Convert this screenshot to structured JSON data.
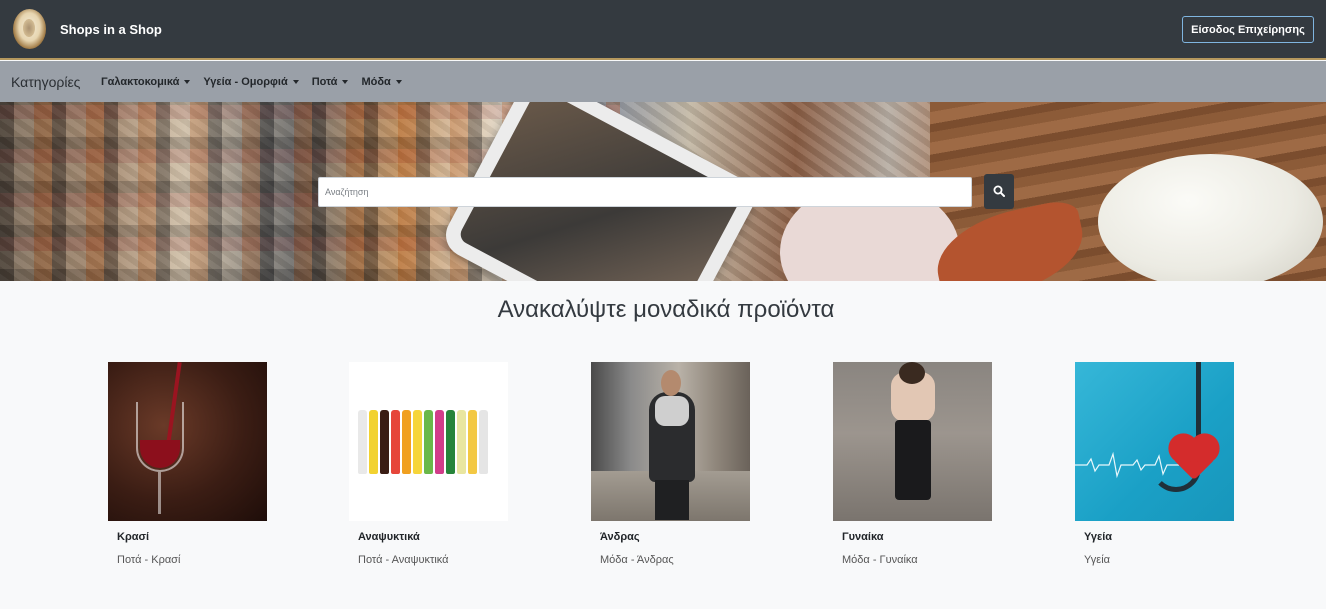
{
  "header": {
    "brand": "Shops in a Shop",
    "login_button": "Είσοδος Επιχείρησης"
  },
  "categories": {
    "title": "Κατηγορίες",
    "items": [
      {
        "label": "Γαλακτοκομικά"
      },
      {
        "label": "Υγεία - Ομορφιά"
      },
      {
        "label": "Ποτά"
      },
      {
        "label": "Μόδα"
      }
    ]
  },
  "search": {
    "placeholder": "Αναζήτηση",
    "button_icon": "search-icon"
  },
  "main": {
    "headline": "Ανακαλύψτε μοναδικά προϊόντα",
    "products": [
      {
        "name": "Κρασί",
        "category": "Ποτά - Κρασί"
      },
      {
        "name": "Αναψυκτικά",
        "category": "Ποτά - Αναψυκτικά"
      },
      {
        "name": "Άνδρας",
        "category": "Μόδα - Άνδρας"
      },
      {
        "name": "Γυναίκα",
        "category": "Μόδα - Γυναίκα"
      },
      {
        "name": "Υγεία",
        "category": "Υγεία"
      }
    ]
  },
  "colors": {
    "topbar": "#343a40",
    "category_bar": "#9aa0a8",
    "page_background": "#f8f9fa",
    "login_border": "#7fb5e0"
  }
}
